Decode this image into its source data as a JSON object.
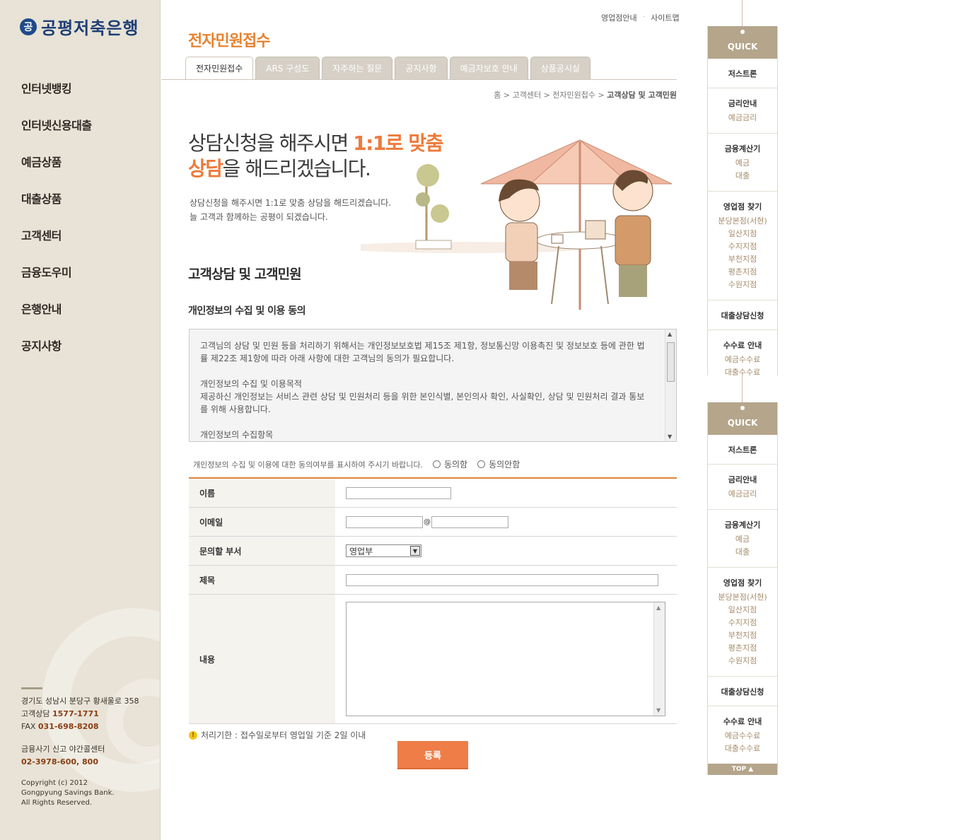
{
  "brand": {
    "logo_mark": "공",
    "logo_text": "공평저축은행"
  },
  "top_links": [
    "영업점안내",
    "사이트맵"
  ],
  "main_nav": [
    "인터넷뱅킹",
    "인터넷신용대출",
    "예금상품",
    "대출상품",
    "고객센터",
    "금융도우미",
    "은행안내",
    "공지사항"
  ],
  "footer": {
    "address": "경기도 성남시 분당구 황새울로 358",
    "consult_label": "고객상담",
    "consult_phone": "1577-1771",
    "fax_label": "FAX",
    "fax": "031-698-8208",
    "fraud_label": "금융사기 신고 야간콜센터",
    "fraud_phone": "02-3978-600, 800",
    "copyright_1": "Copyright (c) 2012",
    "copyright_2": "Gongpyung Savings Bank.",
    "copyright_3": "All Rights Reserved."
  },
  "page_title": "전자민원접수",
  "tabs": [
    "전자민원접수",
    "ARS 구성도",
    "자주하는 질문",
    "공지사항",
    "예금자보호 안내",
    "상품공시실"
  ],
  "active_tab": 0,
  "breadcrumb": {
    "trail": "홈 > 고객센터 > 전자민원접수 > ",
    "current": "고객상담 및 고객민원"
  },
  "hero": {
    "line1_a": "상담신청을 해주시면 ",
    "line1_b": "1:1로 맞춤",
    "line2_a": "상담",
    "line2_b": "을 해드리겠습니다.",
    "desc1": "상담신청을 해주시면 1:1로 맞춤 상담을 해드리겠습니다.",
    "desc2": "늘 고객과 함께하는 공평이 되겠습니다."
  },
  "section_title": "고객상담 및 고객민원",
  "privacy_title": "개인정보의 수집 및 이용 동의",
  "terms": {
    "p1": "고객님의 상담 및 민원 등을 처리하기 위해서는 개인정보보호법 제15조 제1항, 정보통신망 이용촉진 및 정보보호 등에 관한 법률 제22조 제1항에 따라 아래 사항에 대한 고객님의 동의가 필요합니다.",
    "p2_title": "개인정보의 수집 및 이용목적",
    "p2_body": "제공하신 개인정보는 서비스 관련 상담 및 민원처리 등을 위한 본인식별, 본인의사 확인, 사실확인, 상담 및 민원처리 결과 통보를 위해 사용합니다.",
    "p3_title": "개인정보의 수집항목"
  },
  "consent": {
    "text": "개인정보의 수집 및 이용에 대한 동의여부를 표시하여 주시기 바랍니다.",
    "agree": "동의함",
    "disagree": "동의안함"
  },
  "form": {
    "name_label": "이름",
    "email_label": "이메일",
    "email_at": "@",
    "dept_label": "문의할 부서",
    "dept_value": "영업부",
    "subject_label": "제목",
    "content_label": "내용"
  },
  "notice": "처리기한 : 접수일로부터 영업일 기준 2일 이내",
  "submit_label": "등록",
  "quick": {
    "title": "QUICK",
    "groups": [
      {
        "title": "저스트론",
        "items": []
      },
      {
        "title": "금리안내",
        "items": [
          "예금금리"
        ]
      },
      {
        "title": "금융계산기",
        "items": [
          "예금",
          "대출"
        ]
      },
      {
        "title": "영업점 찾기",
        "items": [
          "분당본점(서현)",
          "일산지점",
          "수지지점",
          "부천지점",
          "평촌지점",
          "수원지점"
        ]
      },
      {
        "title": "대출상담신청",
        "items": []
      },
      {
        "title": "수수료 안내",
        "items": [
          "예금수수료",
          "대출수수료"
        ]
      }
    ],
    "top_label": "TOP ▲"
  }
}
